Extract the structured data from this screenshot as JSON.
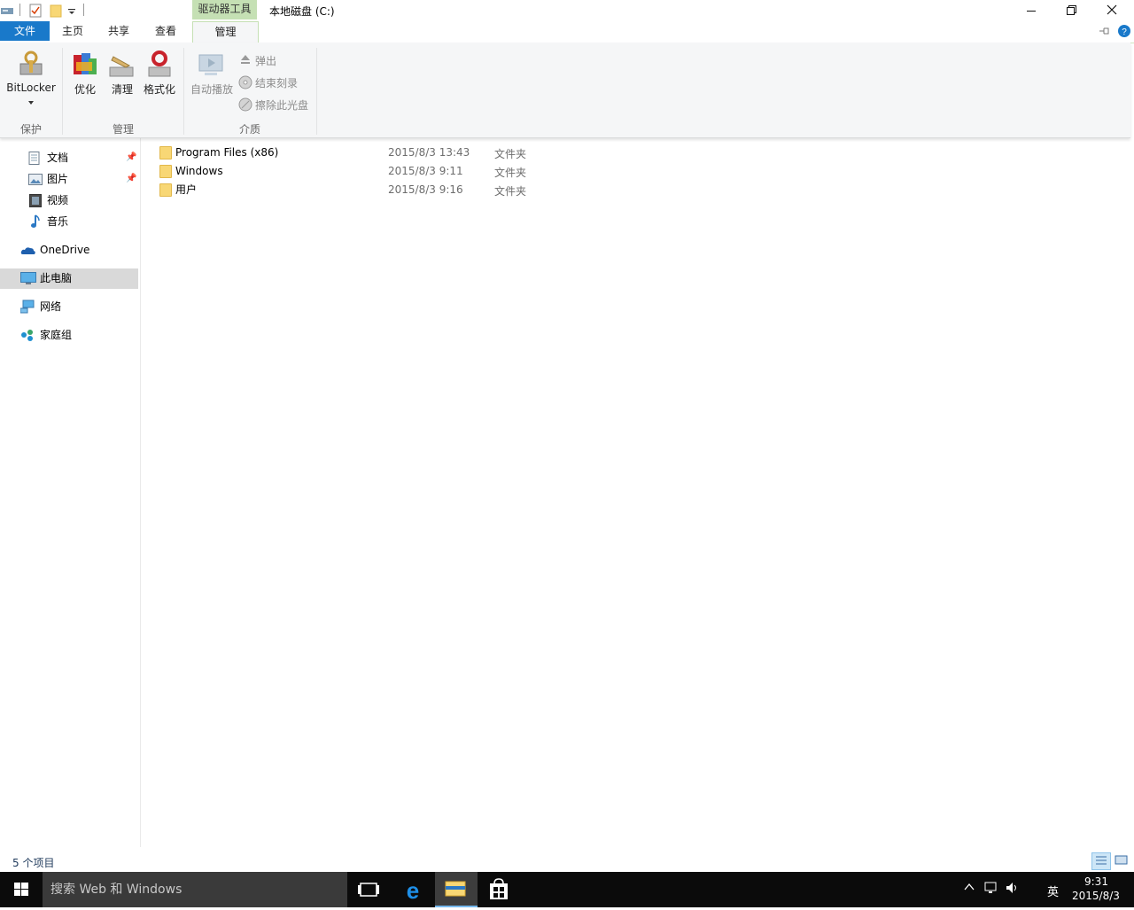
{
  "window": {
    "title": "本地磁盘 (C:)",
    "context_tab_header": "驱动器工具",
    "controls": [
      "minimize",
      "restore",
      "close"
    ]
  },
  "quick_access_toolbar": {
    "icons": [
      "properties-icon",
      "new-folder-icon",
      "customize-qat-icon"
    ]
  },
  "ribbon": {
    "tabs": [
      {
        "label": "文件",
        "active": false
      },
      {
        "label": "主页",
        "active": false
      },
      {
        "label": "共享",
        "active": false
      },
      {
        "label": "查看",
        "active": false
      },
      {
        "label": "管理",
        "active": true
      }
    ],
    "groups": {
      "protect": {
        "label": "保护",
        "bitlocker": "BitLocker"
      },
      "manage": {
        "label": "管理",
        "optimize": "优化",
        "cleanup": "清理",
        "format": "格式化"
      },
      "media": {
        "label": "介质",
        "autoplay": "自动播放",
        "eject": "弹出",
        "finish_burning": "结束刻录",
        "erase_disc": "擦除此光盘"
      }
    }
  },
  "nav_pane": {
    "items": [
      {
        "label": "文档",
        "pinned": true
      },
      {
        "label": "图片",
        "pinned": true
      },
      {
        "label": "视频",
        "pinned": false
      },
      {
        "label": "音乐",
        "pinned": false
      },
      {
        "label": "OneDrive"
      },
      {
        "label": "此电脑",
        "selected": true
      },
      {
        "label": "网络"
      },
      {
        "label": "家庭组"
      }
    ]
  },
  "files": [
    {
      "name": "Program Files (x86)",
      "date": "2015/8/3 13:43",
      "type": "文件夹"
    },
    {
      "name": "Windows",
      "date": "2015/8/3 9:11",
      "type": "文件夹"
    },
    {
      "name": "用户",
      "date": "2015/8/3 9:16",
      "type": "文件夹"
    }
  ],
  "status": {
    "item_count": "5 个项目"
  },
  "taskbar": {
    "search_placeholder": "搜索 Web 和 Windows",
    "ime": "英",
    "time": "9:31",
    "date": "2015/8/3"
  },
  "colors": {
    "file_tab": "#1979ca",
    "context_tab": "#c5e0b4",
    "nav_selected": "#d9d9d9",
    "folder": "#f8d775",
    "taskbar": "#0b0b0b"
  }
}
